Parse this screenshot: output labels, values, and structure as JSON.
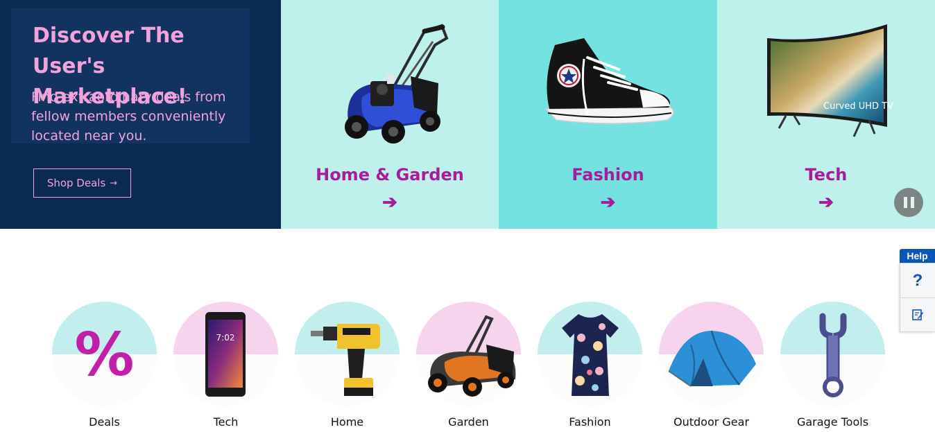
{
  "hero": {
    "title": "Discover The User's Marketplace!",
    "subtitle": "Find extraordinary deals from fellow members conveniently located near you.",
    "shop_button": "Shop Deals",
    "shop_button_icon": "arrow-right-icon",
    "tiles": [
      {
        "label": "Home & Garden",
        "arrow": "➔",
        "image": "lawn-mower-image"
      },
      {
        "label": "Fashion",
        "arrow": "➔",
        "image": "sneaker-image"
      },
      {
        "label": "Tech",
        "arrow": "➔",
        "image": "curved-tv-image",
        "image_text": "Curved UHD TV"
      }
    ],
    "pause_icon": "pause-icon"
  },
  "help": {
    "tab_label": "Help",
    "question_icon_glyph": "?",
    "question_icon": "question-icon",
    "feedback_icon": "feedback-edit-icon"
  },
  "categories": [
    {
      "label": "Deals",
      "icon_text": "%",
      "circle": "teal"
    },
    {
      "label": "Tech",
      "phone_time": "7:02",
      "circle": "pink"
    },
    {
      "label": "Home",
      "circle": "teal"
    },
    {
      "label": "Garden",
      "circle": "pink"
    },
    {
      "label": "Fashion",
      "circle": "teal"
    },
    {
      "label": "Outdoor Gear",
      "circle": "pink"
    },
    {
      "label": "Garage Tools",
      "circle": "teal"
    }
  ],
  "colors": {
    "navy": "#0a2a52",
    "pink_text": "#f3a3dc",
    "magenta": "#a51d9c",
    "teal_light": "#bff1ec",
    "teal": "#73e2e0",
    "help_blue": "#0a56b8"
  }
}
